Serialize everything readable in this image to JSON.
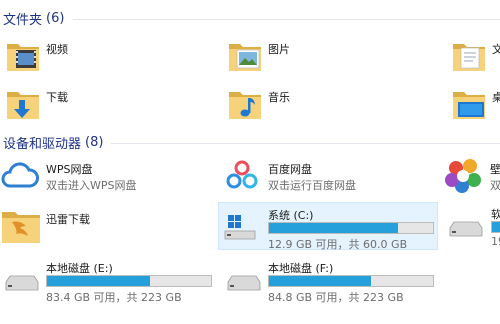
{
  "folders_group": {
    "title": "文件夹",
    "count": "(6)"
  },
  "folders": [
    {
      "name": "视频"
    },
    {
      "name": "图片"
    },
    {
      "name": "文"
    },
    {
      "name": "下载"
    },
    {
      "name": "音乐"
    },
    {
      "name": "桌"
    }
  ],
  "drives_group": {
    "title": "设备和驱动器",
    "count": "(8)"
  },
  "apps": [
    {
      "name": "WPS网盘",
      "desc": "双击进入WPS网盘"
    },
    {
      "name": "百度网盘",
      "desc": "双击运行百度网盘"
    },
    {
      "name": "壁",
      "desc": "双"
    },
    {
      "name": "迅雷下载"
    }
  ],
  "drives": [
    {
      "name": "系统 (C:)",
      "space": "12.9 GB 可用，共 60.0 GB",
      "used_fraction": 0.785,
      "selected": true
    },
    {
      "name": "软",
      "space": "19",
      "used_fraction": 0.5
    },
    {
      "name": "本地磁盘 (E:)",
      "space": "83.4 GB 可用，共 223 GB",
      "used_fraction": 0.63
    },
    {
      "name": "本地磁盘 (F:)",
      "space": "84.8 GB 可用，共 223 GB",
      "used_fraction": 0.62
    }
  ],
  "colors": {
    "header": "#1e3287",
    "bar_fill": "#26a0da",
    "selection": "#e5f3ff"
  }
}
